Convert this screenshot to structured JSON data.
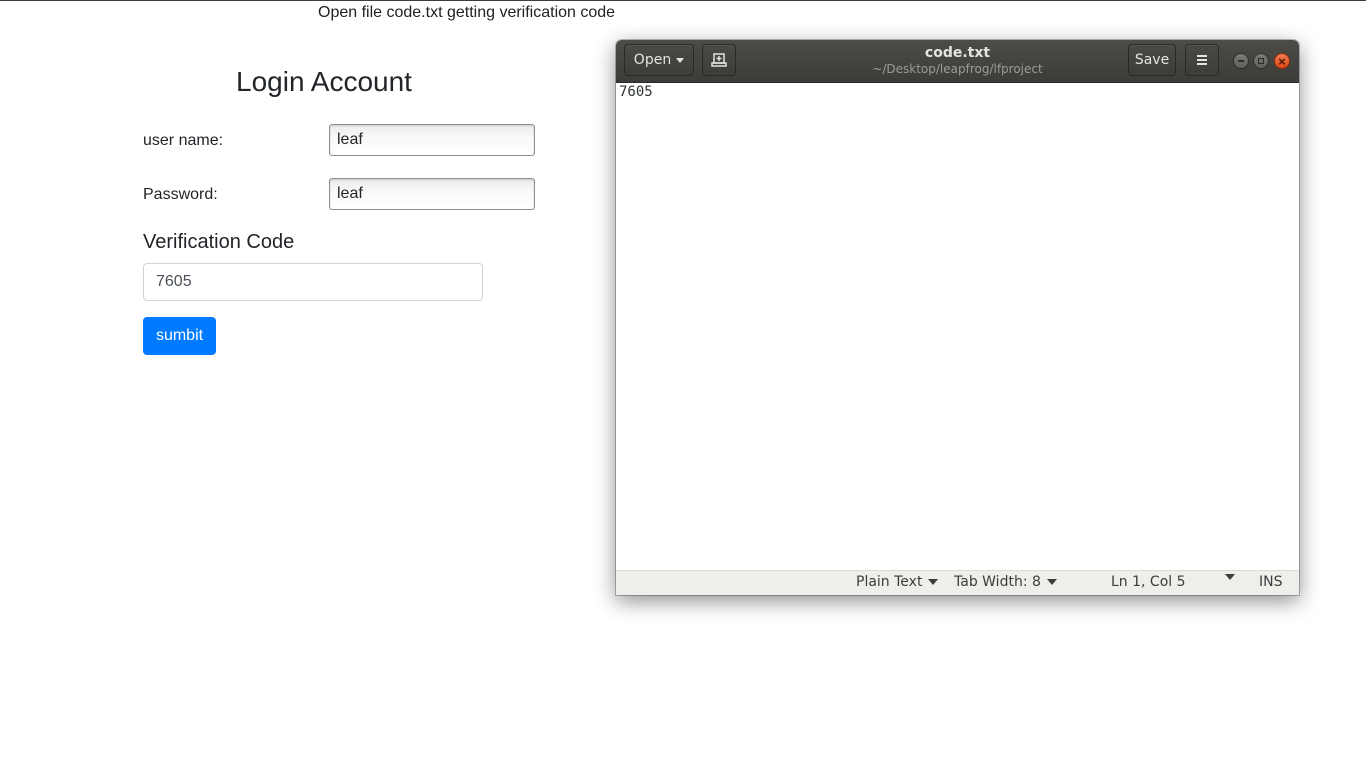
{
  "instruction": "Open file code.txt getting verification code",
  "login": {
    "title": "Login Account",
    "username_label": "user name:",
    "username_value": "leaf",
    "password_label": "Password:",
    "password_value": "leaf",
    "verification_heading": "Verification Code",
    "verification_value": "7605",
    "submit_label": "sumbit",
    "submit_color": "#007bff"
  },
  "gedit": {
    "open_label": "Open",
    "new_doc_icon": "new-document-icon",
    "title": "code.txt",
    "subtitle": "~/Desktop/leapfrog/lfproject",
    "save_label": "Save",
    "menu_icon": "hamburger-menu-icon",
    "content": "7605",
    "status": {
      "language": "Plain Text",
      "tab_width": "Tab Width: 8",
      "position": "Ln 1, Col 5",
      "mode": "INS"
    }
  }
}
